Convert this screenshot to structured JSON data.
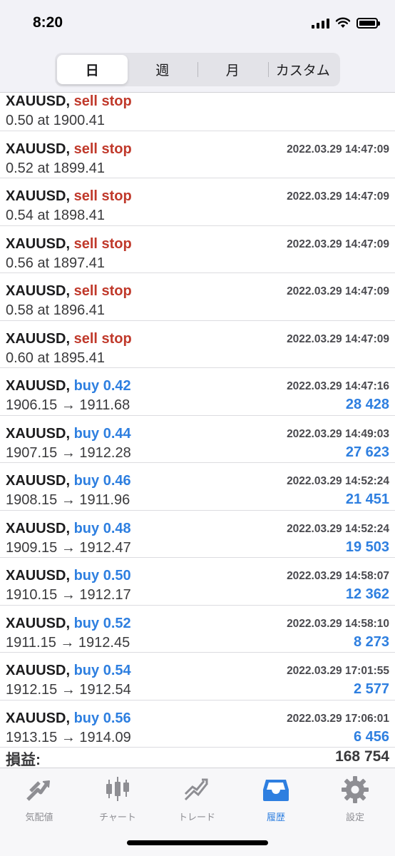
{
  "status": {
    "time": "8:20"
  },
  "segments": [
    "日",
    "週",
    "月",
    "カスタム"
  ],
  "history": [
    {
      "symbol": "XAUUSD,",
      "type": "sell stop",
      "kind": "sell",
      "time": "",
      "detail": "0.50 at 1900.41",
      "profit": ""
    },
    {
      "symbol": "XAUUSD,",
      "type": "sell stop",
      "kind": "sell",
      "time": "2022.03.29 14:47:09",
      "detail": "0.52 at 1899.41",
      "profit": ""
    },
    {
      "symbol": "XAUUSD,",
      "type": "sell stop",
      "kind": "sell",
      "time": "2022.03.29 14:47:09",
      "detail": "0.54 at 1898.41",
      "profit": ""
    },
    {
      "symbol": "XAUUSD,",
      "type": "sell stop",
      "kind": "sell",
      "time": "2022.03.29 14:47:09",
      "detail": "0.56 at 1897.41",
      "profit": ""
    },
    {
      "symbol": "XAUUSD,",
      "type": "sell stop",
      "kind": "sell",
      "time": "2022.03.29 14:47:09",
      "detail": "0.58 at 1896.41",
      "profit": ""
    },
    {
      "symbol": "XAUUSD,",
      "type": "sell stop",
      "kind": "sell",
      "time": "2022.03.29 14:47:09",
      "detail": "0.60 at 1895.41",
      "profit": ""
    },
    {
      "symbol": "XAUUSD,",
      "type": "buy 0.42",
      "kind": "buy",
      "time": "2022.03.29 14:47:16",
      "detail": "1906.15 → 1911.68",
      "profit": "28 428"
    },
    {
      "symbol": "XAUUSD,",
      "type": "buy 0.44",
      "kind": "buy",
      "time": "2022.03.29 14:49:03",
      "detail": "1907.15 → 1912.28",
      "profit": "27 623"
    },
    {
      "symbol": "XAUUSD,",
      "type": "buy 0.46",
      "kind": "buy",
      "time": "2022.03.29 14:52:24",
      "detail": "1908.15 → 1911.96",
      "profit": "21 451"
    },
    {
      "symbol": "XAUUSD,",
      "type": "buy 0.48",
      "kind": "buy",
      "time": "2022.03.29 14:52:24",
      "detail": "1909.15 → 1912.47",
      "profit": "19 503"
    },
    {
      "symbol": "XAUUSD,",
      "type": "buy 0.50",
      "kind": "buy",
      "time": "2022.03.29 14:58:07",
      "detail": "1910.15 → 1912.17",
      "profit": "12 362"
    },
    {
      "symbol": "XAUUSD,",
      "type": "buy 0.52",
      "kind": "buy",
      "time": "2022.03.29 14:58:10",
      "detail": "1911.15 → 1912.45",
      "profit": "8 273"
    },
    {
      "symbol": "XAUUSD,",
      "type": "buy 0.54",
      "kind": "buy",
      "time": "2022.03.29 17:01:55",
      "detail": "1912.15 → 1912.54",
      "profit": "2 577"
    },
    {
      "symbol": "XAUUSD,",
      "type": "buy 0.56",
      "kind": "buy",
      "time": "2022.03.29 17:06:01",
      "detail": "1913.15 → 1914.09",
      "profit": "6 456"
    }
  ],
  "summary": {
    "label": "損益:",
    "value": "168 754"
  },
  "tabs": [
    {
      "label": "気配値",
      "icon": "quotes-icon"
    },
    {
      "label": "チャート",
      "icon": "chart-icon"
    },
    {
      "label": "トレード",
      "icon": "trade-icon"
    },
    {
      "label": "履歴",
      "icon": "history-icon"
    },
    {
      "label": "設定",
      "icon": "settings-icon"
    }
  ],
  "colors": {
    "sell": "#c0392b",
    "buy": "#2e7fe0",
    "active_tab": "#2e7fe0",
    "inactive_tab": "#8e8e93"
  }
}
